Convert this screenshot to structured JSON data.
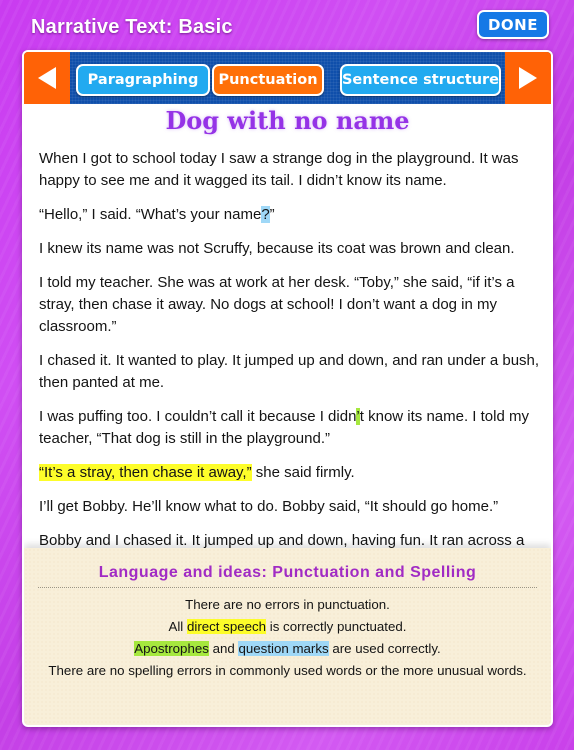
{
  "header": {
    "title": "Narrative Text: Basic",
    "done_label": "DONE"
  },
  "nav": {
    "prev_icon": "triangle-left-icon",
    "next_icon": "triangle-right-icon",
    "tabs": [
      {
        "label": "Paragraphing",
        "active": false
      },
      {
        "label": "Punctuation",
        "active": true
      },
      {
        "label": "Sentence structure",
        "active": false
      }
    ]
  },
  "colors": {
    "background_purple": "#c93bf0",
    "nav_blue": "#0f4fab",
    "arrow_orange": "#ff6206",
    "tab_blue": "#22aaf0",
    "tab_active_orange": "#ff7008",
    "title_purple": "#9533e6",
    "highlight_direct_speech": "#fdfd2a",
    "highlight_apostrophes": "#a6e83e",
    "highlight_question_marks": "#9fd8f7"
  },
  "story": {
    "title": "Dog with no name",
    "paragraphs": {
      "p1": "When I got to school today I saw a strange dog in the playground. It was happy to see me and it wagged its tail. I didn’t know its name.",
      "p2_before": "“Hello,” I said. “What’s your name",
      "p2_highlight": "?",
      "p2_after": "”",
      "p3": "I knew its name was not Scruffy, because its coat was brown and clean.",
      "p4": "I told my teacher. She was at work at her desk. “Toby,” she said, “if it’s a stray, then chase it away. No dogs at school! I don’t want a dog in my classroom.”",
      "p5": "I chased it. It wanted to play. It jumped up and down, and ran under a bush, then panted at me.",
      "p6_before": "I was puffing too. I couldn’t call it because I didn",
      "p6_highlight": "’",
      "p6_after": "t know its name. I told my teacher, “That dog is still in the playground.”",
      "p7_highlight": "“It’s a stray, then chase it away,”",
      "p7_after": " she said firmly.",
      "p8": "I’ll get Bobby. He’ll know what to do. Bobby said, “It should go home.”",
      "p9": "Bobby and I chased it. It jumped up and down, having fun. It ran across a"
    }
  },
  "feedback": {
    "title": "Language and ideas: Punctuation and Spelling",
    "line1": "There are no errors in punctuation.",
    "line2_before": "All ",
    "line2_highlight": "direct speech",
    "line2_after": " is correctly punctuated.",
    "line3_highlight1": "Apostrophes",
    "line3_mid": " and ",
    "line3_highlight2": "question marks",
    "line3_after": " are used correctly.",
    "line4": "There are no spelling errors in commonly used words or the more unusual words."
  }
}
